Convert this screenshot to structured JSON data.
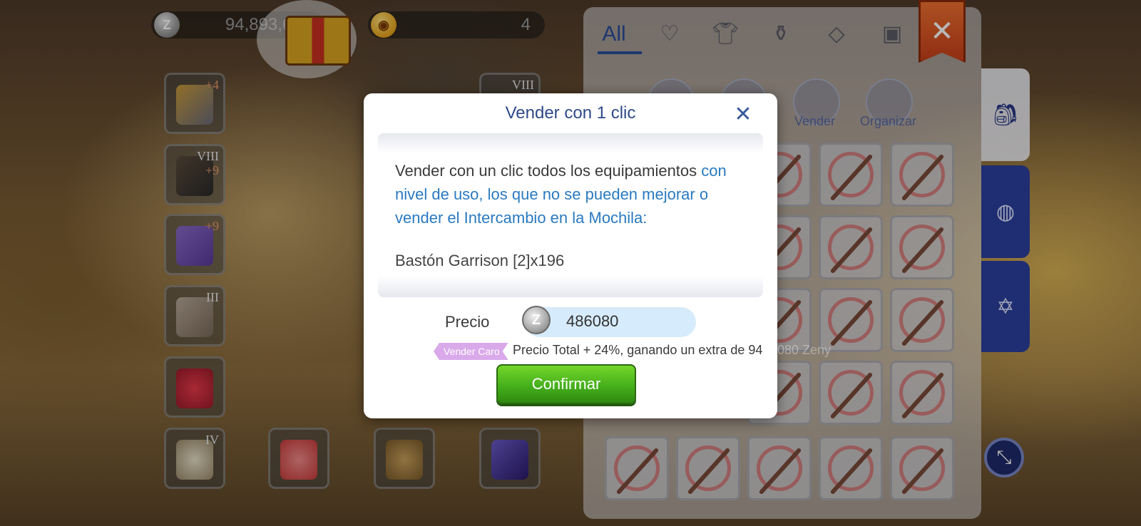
{
  "hud": {
    "zeny_amount": "94,893,686",
    "secondary_currency_amount": "4"
  },
  "equipment_slots": [
    {
      "name": "shield",
      "tier": "",
      "refine": "+4"
    },
    {
      "name": "armor",
      "tier": "VIII",
      "refine": "+9"
    },
    {
      "name": "garment",
      "tier": "",
      "refine": "+9"
    },
    {
      "name": "boots",
      "tier": "III",
      "refine": ""
    },
    {
      "name": "accessory",
      "tier": "",
      "refine": ""
    },
    {
      "name": "accessory-2",
      "tier": "IV",
      "refine": ""
    },
    {
      "name": "weapon",
      "tier": "VIII",
      "refine": ""
    }
  ],
  "inventory": {
    "tabs": [
      {
        "label": "All",
        "icon": ""
      },
      {
        "label": "",
        "icon": "heart-icon"
      },
      {
        "label": "",
        "icon": "shirt-icon"
      },
      {
        "label": "",
        "icon": "potion-icon"
      },
      {
        "label": "",
        "icon": "gem-icon"
      },
      {
        "label": "",
        "icon": "card-icon"
      }
    ],
    "actions": [
      {
        "label": ""
      },
      {
        "label": ""
      },
      {
        "label": "Vender"
      },
      {
        "label": "Organizar"
      }
    ],
    "side_tabs": [
      "backpack-icon",
      "zeny-bag-icon",
      "hexagram-icon"
    ]
  },
  "dialog": {
    "title": "Vender con 1 clic",
    "text_normal": "Vender con un clic todos los equipamientos",
    "text_highlight": "con nivel de uso, los que no se pueden mejorar o vender el Intercambio en la Mochila:",
    "item_line": "Bastón Garrison [2]x196",
    "price_label": "Precio",
    "price_value": "486080",
    "promo_tag": "Vender Caro",
    "promo_text": "Precio Total  + 24%, ganando un extra de 94",
    "promo_overflow": "080 Zeny",
    "confirm_label": "Confirmar"
  },
  "colors": {
    "title_blue": "#2e4a8a",
    "highlight_blue": "#2a7ac0",
    "confirm_green": "#46b01c",
    "promo_purple": "#d9a9ea",
    "inventory_tab_blue": "#2b3f9e"
  }
}
